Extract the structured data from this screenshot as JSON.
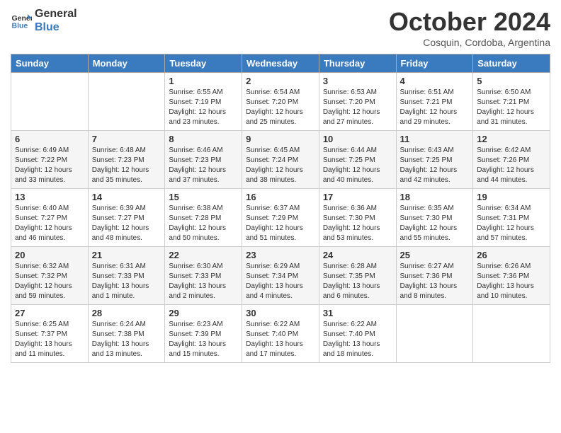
{
  "header": {
    "logo_line1": "General",
    "logo_line2": "Blue",
    "month": "October 2024",
    "location": "Cosquin, Cordoba, Argentina"
  },
  "days_of_week": [
    "Sunday",
    "Monday",
    "Tuesday",
    "Wednesday",
    "Thursday",
    "Friday",
    "Saturday"
  ],
  "weeks": [
    [
      {
        "day": "",
        "sunrise": "",
        "sunset": "",
        "daylight": ""
      },
      {
        "day": "",
        "sunrise": "",
        "sunset": "",
        "daylight": ""
      },
      {
        "day": "1",
        "sunrise": "Sunrise: 6:55 AM",
        "sunset": "Sunset: 7:19 PM",
        "daylight": "Daylight: 12 hours and 23 minutes."
      },
      {
        "day": "2",
        "sunrise": "Sunrise: 6:54 AM",
        "sunset": "Sunset: 7:20 PM",
        "daylight": "Daylight: 12 hours and 25 minutes."
      },
      {
        "day": "3",
        "sunrise": "Sunrise: 6:53 AM",
        "sunset": "Sunset: 7:20 PM",
        "daylight": "Daylight: 12 hours and 27 minutes."
      },
      {
        "day": "4",
        "sunrise": "Sunrise: 6:51 AM",
        "sunset": "Sunset: 7:21 PM",
        "daylight": "Daylight: 12 hours and 29 minutes."
      },
      {
        "day": "5",
        "sunrise": "Sunrise: 6:50 AM",
        "sunset": "Sunset: 7:21 PM",
        "daylight": "Daylight: 12 hours and 31 minutes."
      }
    ],
    [
      {
        "day": "6",
        "sunrise": "Sunrise: 6:49 AM",
        "sunset": "Sunset: 7:22 PM",
        "daylight": "Daylight: 12 hours and 33 minutes."
      },
      {
        "day": "7",
        "sunrise": "Sunrise: 6:48 AM",
        "sunset": "Sunset: 7:23 PM",
        "daylight": "Daylight: 12 hours and 35 minutes."
      },
      {
        "day": "8",
        "sunrise": "Sunrise: 6:46 AM",
        "sunset": "Sunset: 7:23 PM",
        "daylight": "Daylight: 12 hours and 37 minutes."
      },
      {
        "day": "9",
        "sunrise": "Sunrise: 6:45 AM",
        "sunset": "Sunset: 7:24 PM",
        "daylight": "Daylight: 12 hours and 38 minutes."
      },
      {
        "day": "10",
        "sunrise": "Sunrise: 6:44 AM",
        "sunset": "Sunset: 7:25 PM",
        "daylight": "Daylight: 12 hours and 40 minutes."
      },
      {
        "day": "11",
        "sunrise": "Sunrise: 6:43 AM",
        "sunset": "Sunset: 7:25 PM",
        "daylight": "Daylight: 12 hours and 42 minutes."
      },
      {
        "day": "12",
        "sunrise": "Sunrise: 6:42 AM",
        "sunset": "Sunset: 7:26 PM",
        "daylight": "Daylight: 12 hours and 44 minutes."
      }
    ],
    [
      {
        "day": "13",
        "sunrise": "Sunrise: 6:40 AM",
        "sunset": "Sunset: 7:27 PM",
        "daylight": "Daylight: 12 hours and 46 minutes."
      },
      {
        "day": "14",
        "sunrise": "Sunrise: 6:39 AM",
        "sunset": "Sunset: 7:27 PM",
        "daylight": "Daylight: 12 hours and 48 minutes."
      },
      {
        "day": "15",
        "sunrise": "Sunrise: 6:38 AM",
        "sunset": "Sunset: 7:28 PM",
        "daylight": "Daylight: 12 hours and 50 minutes."
      },
      {
        "day": "16",
        "sunrise": "Sunrise: 6:37 AM",
        "sunset": "Sunset: 7:29 PM",
        "daylight": "Daylight: 12 hours and 51 minutes."
      },
      {
        "day": "17",
        "sunrise": "Sunrise: 6:36 AM",
        "sunset": "Sunset: 7:30 PM",
        "daylight": "Daylight: 12 hours and 53 minutes."
      },
      {
        "day": "18",
        "sunrise": "Sunrise: 6:35 AM",
        "sunset": "Sunset: 7:30 PM",
        "daylight": "Daylight: 12 hours and 55 minutes."
      },
      {
        "day": "19",
        "sunrise": "Sunrise: 6:34 AM",
        "sunset": "Sunset: 7:31 PM",
        "daylight": "Daylight: 12 hours and 57 minutes."
      }
    ],
    [
      {
        "day": "20",
        "sunrise": "Sunrise: 6:32 AM",
        "sunset": "Sunset: 7:32 PM",
        "daylight": "Daylight: 12 hours and 59 minutes."
      },
      {
        "day": "21",
        "sunrise": "Sunrise: 6:31 AM",
        "sunset": "Sunset: 7:33 PM",
        "daylight": "Daylight: 13 hours and 1 minute."
      },
      {
        "day": "22",
        "sunrise": "Sunrise: 6:30 AM",
        "sunset": "Sunset: 7:33 PM",
        "daylight": "Daylight: 13 hours and 2 minutes."
      },
      {
        "day": "23",
        "sunrise": "Sunrise: 6:29 AM",
        "sunset": "Sunset: 7:34 PM",
        "daylight": "Daylight: 13 hours and 4 minutes."
      },
      {
        "day": "24",
        "sunrise": "Sunrise: 6:28 AM",
        "sunset": "Sunset: 7:35 PM",
        "daylight": "Daylight: 13 hours and 6 minutes."
      },
      {
        "day": "25",
        "sunrise": "Sunrise: 6:27 AM",
        "sunset": "Sunset: 7:36 PM",
        "daylight": "Daylight: 13 hours and 8 minutes."
      },
      {
        "day": "26",
        "sunrise": "Sunrise: 6:26 AM",
        "sunset": "Sunset: 7:36 PM",
        "daylight": "Daylight: 13 hours and 10 minutes."
      }
    ],
    [
      {
        "day": "27",
        "sunrise": "Sunrise: 6:25 AM",
        "sunset": "Sunset: 7:37 PM",
        "daylight": "Daylight: 13 hours and 11 minutes."
      },
      {
        "day": "28",
        "sunrise": "Sunrise: 6:24 AM",
        "sunset": "Sunset: 7:38 PM",
        "daylight": "Daylight: 13 hours and 13 minutes."
      },
      {
        "day": "29",
        "sunrise": "Sunrise: 6:23 AM",
        "sunset": "Sunset: 7:39 PM",
        "daylight": "Daylight: 13 hours and 15 minutes."
      },
      {
        "day": "30",
        "sunrise": "Sunrise: 6:22 AM",
        "sunset": "Sunset: 7:40 PM",
        "daylight": "Daylight: 13 hours and 17 minutes."
      },
      {
        "day": "31",
        "sunrise": "Sunrise: 6:22 AM",
        "sunset": "Sunset: 7:40 PM",
        "daylight": "Daylight: 13 hours and 18 minutes."
      },
      {
        "day": "",
        "sunrise": "",
        "sunset": "",
        "daylight": ""
      },
      {
        "day": "",
        "sunrise": "",
        "sunset": "",
        "daylight": ""
      }
    ]
  ]
}
